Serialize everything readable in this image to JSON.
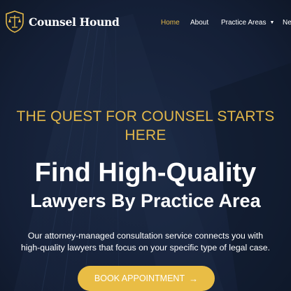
{
  "brand": {
    "name": "Counsel Hound",
    "logo_icon": "scales-shield-icon"
  },
  "nav": {
    "items": [
      {
        "label": "Home",
        "active": true
      },
      {
        "label": "About"
      },
      {
        "label": "Practice Areas",
        "has_dropdown": true,
        "icon": "chevron-down-icon"
      },
      {
        "label": "Ne"
      }
    ]
  },
  "hero": {
    "tagline_line1": "THE QUEST FOR COUNSEL STARTS",
    "tagline_line2": "HERE",
    "headline_line1": "Find High-Quality",
    "headline_line2": "Lawyers By Practice Area",
    "description_line1": "Our attorney-managed consultation service connects you with",
    "description_line2": "high-quality lawyers that focus on your specific type of legal case.",
    "cta_label": "BOOK APPOINTMENT",
    "cta_icon": "arrow-right-icon"
  },
  "colors": {
    "accent": "#e3b84a",
    "button": "#e9bd45",
    "background": "#17243d",
    "text": "#ffffff"
  }
}
